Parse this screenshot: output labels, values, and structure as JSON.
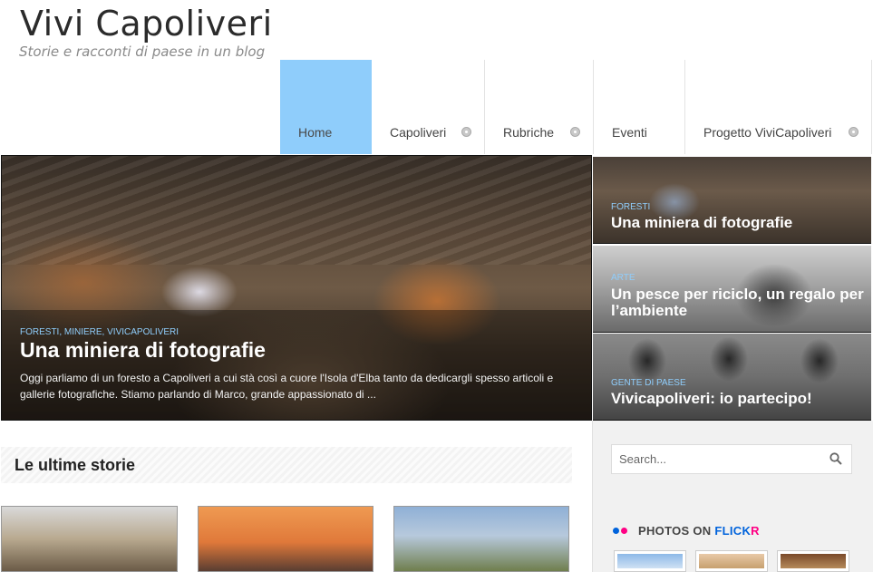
{
  "header": {
    "site_title": "Vivi Capoliveri",
    "tagline": "Storie e racconti di paese in un blog"
  },
  "nav": {
    "items": [
      {
        "label": "Home",
        "active": true,
        "has_submenu": false
      },
      {
        "label": "Capoliveri",
        "active": false,
        "has_submenu": true
      },
      {
        "label": "Rubriche",
        "active": false,
        "has_submenu": true
      },
      {
        "label": "Eventi",
        "active": false,
        "has_submenu": false
      },
      {
        "label": "Progetto ViviCapoliveri",
        "active": false,
        "has_submenu": true
      }
    ]
  },
  "featured": {
    "categories": "FORESTI, MINIERE, VIVICAPOLIVERI",
    "title": "Una miniera di fotografie",
    "excerpt": "Oggi parliamo di un foresto a Capoliveri a cui stà così a cuore l'Isola d'Elba tanto da dedicargli spesso articoli e gallerie fotografiche. Stiamo parlando di Marco, grande appassionato di ..."
  },
  "side_stories": [
    {
      "category": "FORESTI",
      "title": "Una miniera di fotografie"
    },
    {
      "category": "ARTE",
      "title": "Un pesce per riciclo, un regalo per l’ambiente"
    },
    {
      "category": "GENTE DI PAESE",
      "title": "Vivicapoliveri: io partecipo!"
    }
  ],
  "latest": {
    "heading": "Le ultime storie"
  },
  "sidebar": {
    "search_placeholder": "Search...",
    "flickr_prefix": "PHOTOS ON ",
    "flickr_blue": "FLICK",
    "flickr_pink": "R"
  },
  "colors": {
    "accent": "#8fcdfb",
    "flickr_blue": "#0063dc",
    "flickr_pink": "#ff0084"
  },
  "icons": {
    "search": "search-icon",
    "submenu": "submenu-arrow-icon",
    "flickr": "flickr-icon"
  }
}
